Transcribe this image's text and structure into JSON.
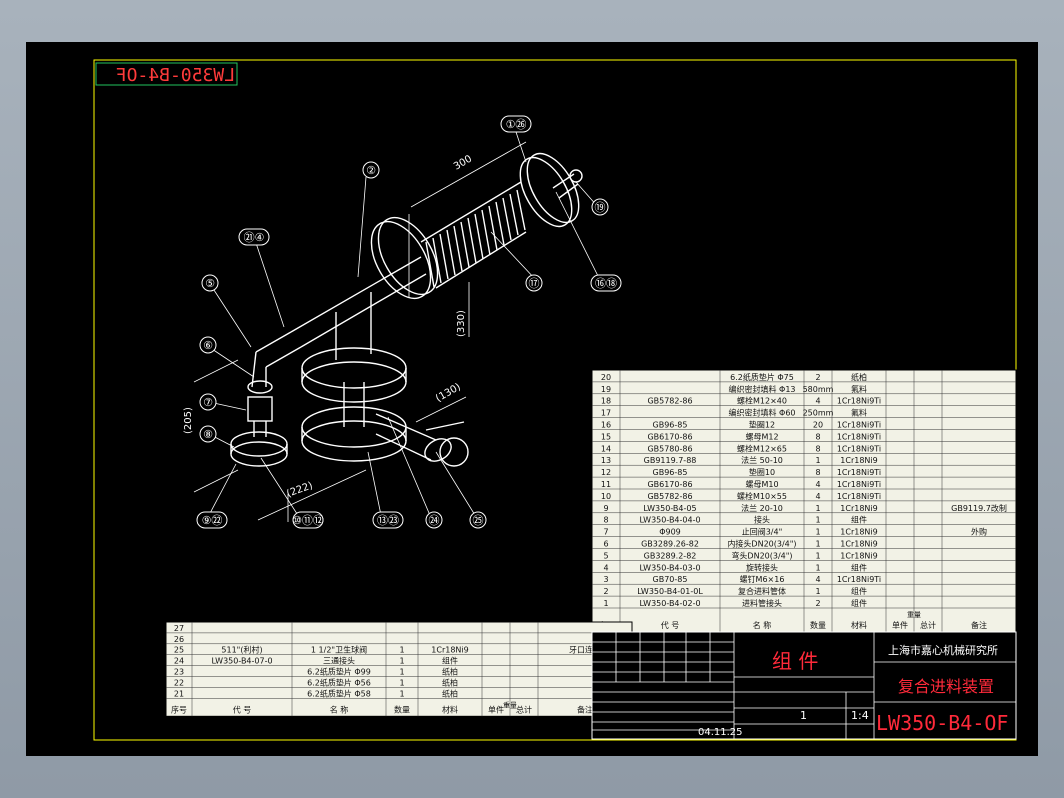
{
  "drawing": {
    "stamp_mirrored": "LW350-B4-OF",
    "title_company": "上海市嘉心机械研究所",
    "title_name": "复合进料装置",
    "title_code": "LW350-B4-OF",
    "title_type": "组  件",
    "title_date": "04.11.25",
    "title_scale": "1:4",
    "title_sheet": "1"
  },
  "dimensions": [
    "300",
    "(330)",
    "(205)",
    "(130)",
    "(222)"
  ],
  "balloons": [
    "①㉖",
    "②",
    "㉑④",
    "⑤",
    "⑥",
    "⑦",
    "⑧",
    "⑨㉒",
    "⑩⑪⑫",
    "⑬㉓",
    "㉔",
    "㉕",
    "⑰",
    "⑯⑱",
    "⑲"
  ],
  "bom_right": {
    "header": [
      "序号",
      "代 号",
      "名 称",
      "数量",
      "材料",
      "单件",
      "总计",
      "备注"
    ],
    "header_mass": "重量",
    "rows": [
      [
        "20",
        "",
        "6.2纸质垫片 Φ75",
        "2",
        "纸柏",
        "",
        "",
        ""
      ],
      [
        "19",
        "",
        "编织密封填料 Φ13",
        "580mm",
        "氟料",
        "",
        "",
        ""
      ],
      [
        "18",
        "GB5782-86",
        "螺栓M12×40",
        "4",
        "1Cr18Ni9Ti",
        "",
        "",
        ""
      ],
      [
        "17",
        "",
        "编织密封填料 Φ60",
        "250mm",
        "氟料",
        "",
        "",
        ""
      ],
      [
        "16",
        "GB96-85",
        "垫圈12",
        "20",
        "1Cr18Ni9Ti",
        "",
        "",
        ""
      ],
      [
        "15",
        "GB6170-86",
        "螺母M12",
        "8",
        "1Cr18Ni9Ti",
        "",
        "",
        ""
      ],
      [
        "14",
        "GB5780-86",
        "螺栓M12×65",
        "8",
        "1Cr18Ni9Ti",
        "",
        "",
        ""
      ],
      [
        "13",
        "GB9119.7-88",
        "法兰 50-10",
        "1",
        "1Cr18Ni9",
        "",
        "",
        ""
      ],
      [
        "12",
        "GB96-85",
        "垫圈10",
        "8",
        "1Cr18Ni9Ti",
        "",
        "",
        ""
      ],
      [
        "11",
        "GB6170-86",
        "螺母M10",
        "4",
        "1Cr18Ni9Ti",
        "",
        "",
        ""
      ],
      [
        "10",
        "GB5782-86",
        "螺栓M10×55",
        "4",
        "1Cr18Ni9Ti",
        "",
        "",
        ""
      ],
      [
        "9",
        "LW350-B4-05",
        "法兰 20-10",
        "1",
        "1Cr18Ni9",
        "",
        "",
        "GB9119.7改制"
      ],
      [
        "8",
        "LW350-B4-04-0",
        "接头",
        "1",
        "组件",
        "",
        "",
        ""
      ],
      [
        "7",
        "Φ909",
        "止回阀3/4\"",
        "1",
        "1Cr18Ni9",
        "",
        "",
        "外购"
      ],
      [
        "6",
        "GB3289.26-82",
        "内接头DN20(3/4\")",
        "1",
        "1Cr18Ni9",
        "",
        "",
        ""
      ],
      [
        "5",
        "GB3289.2-82",
        "弯头DN20(3/4\")",
        "1",
        "1Cr18Ni9",
        "",
        "",
        ""
      ],
      [
        "4",
        "LW350-B4-03-0",
        "旋转接头",
        "1",
        "组件",
        "",
        "",
        ""
      ],
      [
        "3",
        "GB70-85",
        "螺钉M6×16",
        "4",
        "1Cr18Ni9Ti",
        "",
        "",
        ""
      ],
      [
        "2",
        "LW350-B4-01-0L",
        "复合进料管体",
        "1",
        "组件",
        "",
        "",
        ""
      ],
      [
        "1",
        "LW350-B4-02-0",
        "进料管接头",
        "2",
        "组件",
        "",
        "",
        ""
      ]
    ]
  },
  "bom_left": {
    "header": [
      "序号",
      "代 号",
      "名 称",
      "数量",
      "材料",
      "单件",
      "总计",
      "备注"
    ],
    "header_mass": "重量",
    "rows": [
      [
        "27",
        "",
        "",
        "",
        "",
        "",
        "",
        ""
      ],
      [
        "26",
        "",
        "",
        "",
        "",
        "",
        "",
        ""
      ],
      [
        "25",
        "511\"(利村)",
        "1 1/2\"卫生球阀",
        "1",
        "1Cr18Ni9",
        "",
        "",
        "牙口连接"
      ],
      [
        "24",
        "LW350-B4-07-0",
        "三通接头",
        "1",
        "组件",
        "",
        "",
        ""
      ],
      [
        "23",
        "",
        "6.2纸质垫片 Φ99",
        "1",
        "纸柏",
        "",
        "",
        ""
      ],
      [
        "22",
        "",
        "6.2纸质垫片 Φ56",
        "1",
        "纸柏",
        "",
        "",
        ""
      ],
      [
        "21",
        "",
        "6.2纸质垫片 Φ58",
        "1",
        "纸柏",
        "",
        "",
        ""
      ]
    ]
  },
  "colors": {
    "bg": "#000000",
    "frame": "#ffff00",
    "line": "#ffffff",
    "table_fill": "#f2f2e6",
    "title_red": "#ff2a3a",
    "stamp_green": "#22c55e",
    "cyan": "#00d9ff"
  }
}
